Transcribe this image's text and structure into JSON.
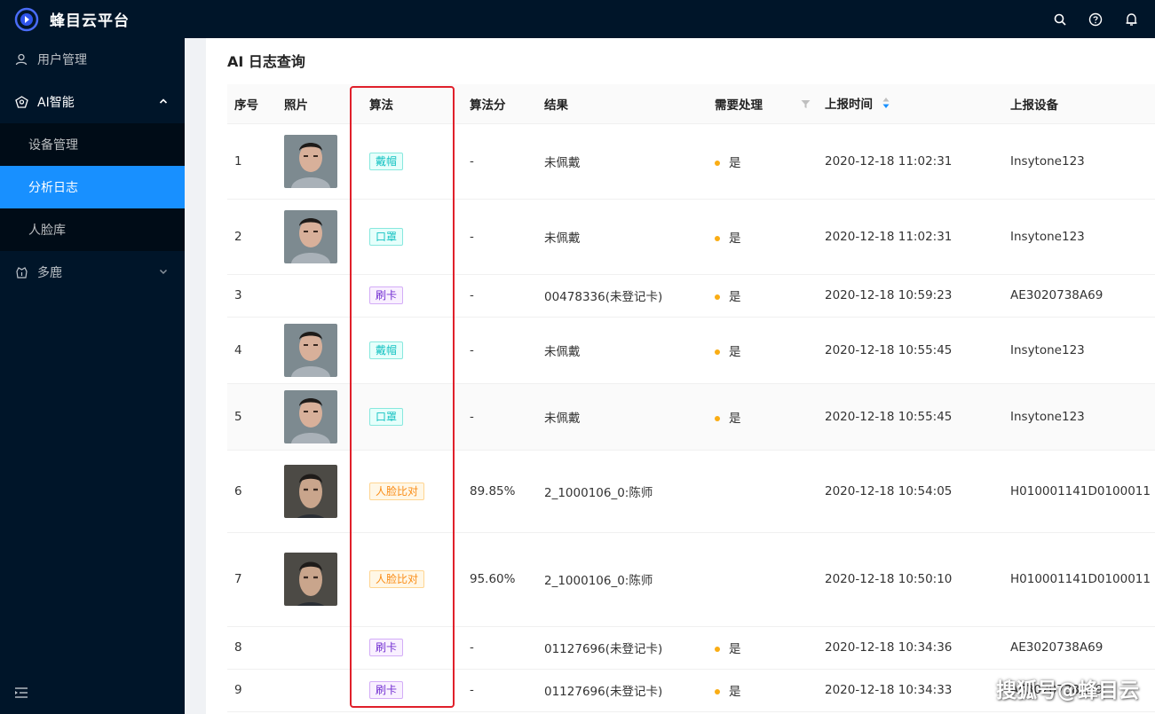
{
  "app": {
    "brand": "蜂目云平台"
  },
  "topbar": {
    "icons": [
      "search-icon",
      "help-icon",
      "bell-icon"
    ]
  },
  "sidebar": {
    "items": [
      {
        "label": "用户管理",
        "icon": "user-icon"
      },
      {
        "label": "AI智能",
        "icon": "ai-icon",
        "expanded": true
      },
      {
        "label": "设备管理"
      },
      {
        "label": "分析日志",
        "active": true
      },
      {
        "label": "人脸库"
      },
      {
        "label": "多鹿",
        "icon": "deer-icon",
        "expanded": false
      }
    ],
    "footer_icon": "menu-fold-icon"
  },
  "page": {
    "title": "AI 日志查询"
  },
  "table": {
    "columns": [
      "序号",
      "照片",
      "算法",
      "算法分",
      "结果",
      "需要处理",
      "上报时间",
      "上报设备"
    ],
    "rows": [
      {
        "no": "1",
        "photo": "person-a",
        "algo": "戴帽",
        "tag": "cyan",
        "score": "-",
        "result": "未佩戴",
        "handle": "是",
        "time": "2020-12-18 11:02:31",
        "device": "Insytone123"
      },
      {
        "no": "2",
        "photo": "person-a",
        "algo": "口罩",
        "tag": "cyan",
        "score": "-",
        "result": "未佩戴",
        "handle": "是",
        "time": "2020-12-18 11:02:31",
        "device": "Insytone123"
      },
      {
        "no": "3",
        "photo": "",
        "algo": "刷卡",
        "tag": "purple",
        "score": "-",
        "result": "00478336(未登记卡)",
        "handle": "是",
        "time": "2020-12-18 10:59:23",
        "device": "AE3020738A69"
      },
      {
        "no": "4",
        "photo": "person-a",
        "algo": "戴帽",
        "tag": "cyan",
        "score": "-",
        "result": "未佩戴",
        "handle": "是",
        "time": "2020-12-18 10:55:45",
        "device": "Insytone123"
      },
      {
        "no": "5",
        "photo": "person-a",
        "algo": "口罩",
        "tag": "cyan",
        "score": "-",
        "result": "未佩戴",
        "handle": "是",
        "time": "2020-12-18 10:55:45",
        "device": "Insytone123"
      },
      {
        "no": "6",
        "photo": "person-b",
        "algo": "人脸比对",
        "tag": "gold",
        "score": "89.85%",
        "result": "2_1000106_0:陈师",
        "handle": "",
        "time": "2020-12-18 10:54:05",
        "device": "H010001141D0100011"
      },
      {
        "no": "7",
        "photo": "person-b",
        "algo": "人脸比对",
        "tag": "gold",
        "score": "95.60%",
        "result": "2_1000106_0:陈师",
        "handle": "",
        "time": "2020-12-18 10:50:10",
        "device": "H010001141D0100011"
      },
      {
        "no": "8",
        "photo": "",
        "algo": "刷卡",
        "tag": "purple",
        "score": "-",
        "result": "01127696(未登记卡)",
        "handle": "是",
        "time": "2020-12-18 10:34:36",
        "device": "AE3020738A69"
      },
      {
        "no": "9",
        "photo": "",
        "algo": "刷卡",
        "tag": "purple",
        "score": "-",
        "result": "01127696(未登记卡)",
        "handle": "是",
        "time": "2020-12-18 10:34:33",
        "device": "AE3020738A69"
      }
    ]
  },
  "watermark": "搜狐号@蜂目云"
}
